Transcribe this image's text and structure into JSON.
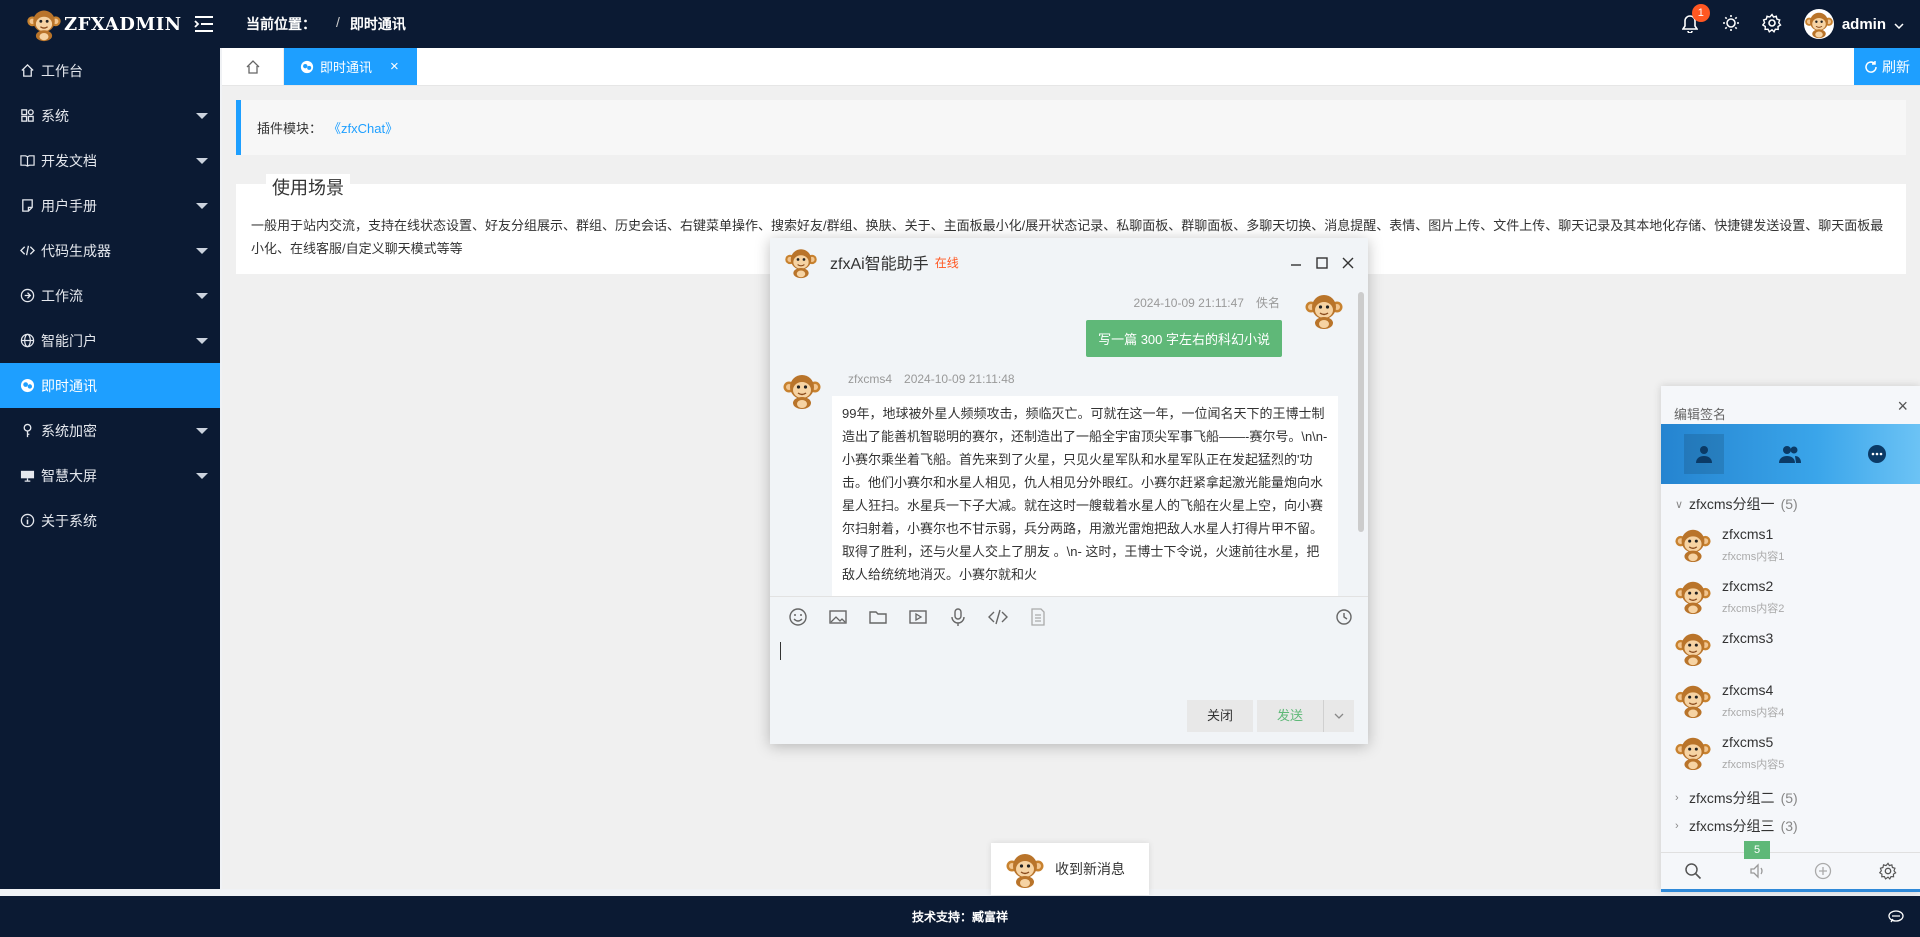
{
  "header": {
    "logo_text": "ZFXADMIN",
    "breadcrumb_label": "当前位置：",
    "breadcrumb_sep": "/",
    "breadcrumb_current": "即时通讯",
    "notification_count": "1",
    "username": "admin"
  },
  "sidebar": {
    "items": [
      {
        "label": "工作台",
        "icon": "home-icon",
        "has_caret": false
      },
      {
        "label": "系统",
        "icon": "apps-icon",
        "has_caret": true
      },
      {
        "label": "开发文档",
        "icon": "book-icon",
        "has_caret": true
      },
      {
        "label": "用户手册",
        "icon": "note-icon",
        "has_caret": true
      },
      {
        "label": "代码生成器",
        "icon": "code-icon",
        "has_caret": true
      },
      {
        "label": "工作流",
        "icon": "flow-icon",
        "has_caret": true
      },
      {
        "label": "智能门户",
        "icon": "globe-icon",
        "has_caret": true
      },
      {
        "label": "即时通讯",
        "icon": "chat-icon",
        "has_caret": false,
        "active": true
      },
      {
        "label": "系统加密",
        "icon": "key-icon",
        "has_caret": true
      },
      {
        "label": "智慧大屏",
        "icon": "screen-icon",
        "has_caret": true
      },
      {
        "label": "关于系统",
        "icon": "info-icon",
        "has_caret": false
      }
    ]
  },
  "tabs": {
    "active_label": "即时通讯",
    "close": "×",
    "refresh_label": "刷新"
  },
  "content": {
    "plugin_label": "插件模块：",
    "plugin_link": "《zfxChat》",
    "scene_title": "使用场景",
    "scene_text": "一般用于站内交流，支持在线状态设置、好友分组展示、群组、历史会话、右键菜单操作、搜索好友/群组、换肤、关于、主面板最小化/展开状态记录、私聊面板、群聊面板、多聊天切换、消息提醒、表情、图片上传、文件上传、聊天记录及其本地化存储、快捷键发送设置、聊天面板最小化、在线客服/自定义聊天模式等等"
  },
  "chat": {
    "title": "zfxAi智能助手",
    "status": "在线",
    "me": {
      "time": "2024-10-09 21:11:47",
      "name": "佚名",
      "text": "写一篇 300 字左右的科幻小说"
    },
    "other": {
      "name": "zfxcms4",
      "time": "2024-10-09 21:11:48",
      "text": "99年，地球被外星人频频攻击，频临灭亡。可就在这一年，一位闻名天下的王博士制造出了能善机智聪明的赛尔，还制造出了一船全宇宙顶尖军事飞船——-赛尔号。\\n\\n- 小赛尔乘坐着飞船。首先来到了火星，只见火星军队和水星军队正在发起猛烈的'功击。他们小赛尔和水星人相见，仇人相见分外眼红。小赛尔赶紧拿起激光能量炮向水星人狂扫。水星兵一下子大减。就在这时一艘载着水星人的飞船在火星上空，向小赛尔扫射着，小赛尔也不甘示弱，兵分两路，用激光雷炮把敌人水星人打得片甲不留。取得了胜利，还与火星人交上了朋友 。\\n- 这时，王博士下令说，火速前往水星，把敌人给统统地消灭。小赛尔就和火"
    },
    "close_label": "关闭",
    "send_label": "发送"
  },
  "im": {
    "sign_label": "编辑签名",
    "close": "×",
    "groups": [
      {
        "name": "zfxcms分组一",
        "count": "(5)",
        "expanded": true,
        "friends": [
          {
            "name": "zfxcms1",
            "sign": "zfxcms内容1"
          },
          {
            "name": "zfxcms2",
            "sign": "zfxcms内容2"
          },
          {
            "name": "zfxcms3",
            "sign": ""
          },
          {
            "name": "zfxcms4",
            "sign": "zfxcms内容4"
          },
          {
            "name": "zfxcms5",
            "sign": "zfxcms内容5"
          }
        ]
      },
      {
        "name": "zfxcms分组二",
        "count": "(5)",
        "expanded": false
      },
      {
        "name": "zfxcms分组三",
        "count": "(3)",
        "expanded": false
      }
    ],
    "msgbox_count": "5"
  },
  "toast": {
    "text": "收到新消息"
  },
  "footer": {
    "text": "技术支持：臧富祥"
  },
  "colors": {
    "primary": "#1e9fff",
    "dark": "#0b1a33",
    "green": "#5fb878",
    "red": "#ff5722"
  }
}
